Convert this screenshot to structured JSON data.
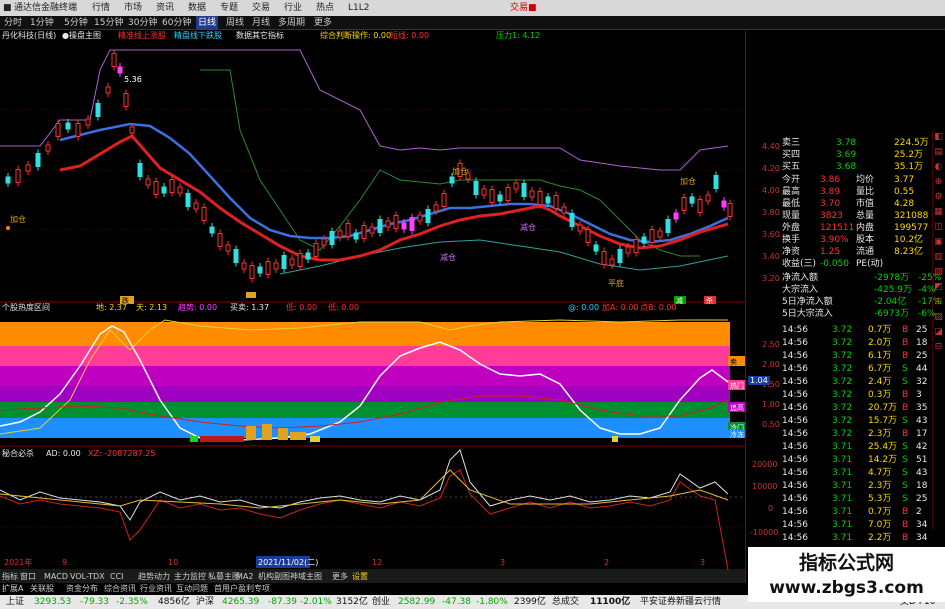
{
  "titlebar": {
    "app_title": "通达信金融终端",
    "menus": [
      "行情",
      "市场",
      "资讯",
      "数据",
      "专题",
      "交易",
      "行业",
      "热点",
      "L1L2"
    ],
    "right_label": "交易■"
  },
  "periods": [
    "分时",
    "1分钟",
    "5分钟",
    "15分钟",
    "30分钟",
    "60分钟",
    "日线",
    "周线",
    "月线",
    "多周期",
    "更多"
  ],
  "active_period": "日线",
  "main_legend": {
    "stock": "丹化科技(日线)",
    "indicator": "●操盘主图",
    "item1": "精准线上涨股",
    "item2": "精盘线下跌股",
    "item3": "数据其它指标",
    "item4": "综合判断操作: 0.00",
    "item5": "短线: 0.00",
    "item6": "压力1: 4.12",
    "price_peak": "5.36"
  },
  "sub_legend": {
    "name": "个股热度区间",
    "v1": "地: 2.37",
    "v2": "天: 2.13",
    "v3": "趋势: 0.00",
    "v4": "买卖: 1.37",
    "v5": "低: 0.00",
    "v6": "低: 0.00",
    "v7": "@: 0.00",
    "v8": "加A: 0.00",
    "v9": "点B: 0.00"
  },
  "ad_legend": {
    "name": "秘合必杀",
    "ad": "AD: 0.00",
    "xz": "XZ: -2087287.25"
  },
  "main_axis": [
    "4.40",
    "4.20",
    "4.00",
    "3.80",
    "3.60",
    "3.40",
    "3.20"
  ],
  "sub_axis": [
    "2.50",
    "2.00",
    "1.50",
    "1.00",
    "0.50"
  ],
  "ad_axis": [
    "20000",
    "10000",
    "0",
    "-10000"
  ],
  "zone_labels": [
    "卖",
    "热门",
    "追高",
    "冷门",
    "冷冻"
  ],
  "zone_value": "1.04",
  "chart_markers": {
    "buy_left": "加仓",
    "reduce": "减仓",
    "buy_mid": "加仓",
    "reduce2": "减仓",
    "buy_right": "加仓",
    "low_buy": "平底",
    "tag_jie": "跌",
    "tag_low": "低",
    "tag_mai": "减",
    "tag_ji": "杀"
  },
  "date_labels": [
    "2021年",
    "9",
    "10",
    "2021/11/02(二)",
    "12",
    "3",
    "2",
    "3"
  ],
  "quote": {
    "ask3": {
      "label": "卖三",
      "price": "3.78",
      "vol": "224.5万"
    },
    "ask4": {
      "label": "买四",
      "price": "3.69",
      "vol": "25.2万"
    },
    "ask5": {
      "label": "买五",
      "price": "3.68",
      "vol": "35.1万"
    },
    "rows": [
      {
        "l1": "今开",
        "v1": "3.86",
        "l2": "均价",
        "v2": "3.77"
      },
      {
        "l1": "最高",
        "v1": "3.89",
        "l2": "量比",
        "v2": "0.55"
      },
      {
        "l1": "最低",
        "v1": "3.70",
        "l2": "市值",
        "v2": "4.28"
      },
      {
        "l1": "现量",
        "v1": "3823",
        "l2": "总量",
        "v2": "321088"
      },
      {
        "l1": "外盘",
        "v1": "121511",
        "l2": "内盘",
        "v2": "199577"
      },
      {
        "l1": "换手",
        "v1": "3.90%",
        "l2": "股本",
        "v2": "10.2亿"
      },
      {
        "l1": "净资",
        "v1": "1.25",
        "l2": "流通",
        "v2": "8.23亿"
      },
      {
        "l1": "收益(三)",
        "v1": "-0.050",
        "l2": "PE(动)",
        "v2": ""
      }
    ],
    "flows": [
      {
        "label": "净流入额",
        "value": "-2978万",
        "pct": "-25%"
      },
      {
        "label": "大宗流入",
        "value": "-425.9万",
        "pct": "-4%"
      },
      {
        "label": "5日净流入额",
        "value": "-2.04亿",
        "pct": "-17%"
      },
      {
        "label": "5日大宗流入",
        "value": "-6973万",
        "pct": "-6%"
      }
    ]
  },
  "ticks": [
    {
      "t": "14:56",
      "p": "3.72",
      "v": "0.7万",
      "s": "B",
      "n": "25"
    },
    {
      "t": "14:56",
      "p": "3.72",
      "v": "2.0万",
      "s": "B",
      "n": "18"
    },
    {
      "t": "14:56",
      "p": "3.72",
      "v": "6.1万",
      "s": "B",
      "n": "25"
    },
    {
      "t": "14:56",
      "p": "3.72",
      "v": "6.7万",
      "s": "S",
      "n": "44"
    },
    {
      "t": "14:56",
      "p": "3.72",
      "v": "2.4万",
      "s": "S",
      "n": "32"
    },
    {
      "t": "14:56",
      "p": "3.72",
      "v": "0.3万",
      "s": "B",
      "n": "3"
    },
    {
      "t": "14:56",
      "p": "3.72",
      "v": "20.7万",
      "s": "B",
      "n": "35"
    },
    {
      "t": "14:56",
      "p": "3.72",
      "v": "15.7万",
      "s": "S",
      "n": "43"
    },
    {
      "t": "14:56",
      "p": "3.72",
      "v": "2.3万",
      "s": "B",
      "n": "17"
    },
    {
      "t": "14:56",
      "p": "3.71",
      "v": "25.4万",
      "s": "S",
      "n": "42"
    },
    {
      "t": "14:56",
      "p": "3.71",
      "v": "14.2万",
      "s": "S",
      "n": "51"
    },
    {
      "t": "14:56",
      "p": "3.71",
      "v": "4.7万",
      "s": "S",
      "n": "43"
    },
    {
      "t": "14:56",
      "p": "3.71",
      "v": "2.3万",
      "s": "S",
      "n": "18"
    },
    {
      "t": "14:56",
      "p": "3.71",
      "v": "5.3万",
      "s": "S",
      "n": "25"
    },
    {
      "t": "14:56",
      "p": "3.71",
      "v": "0.7万",
      "s": "B",
      "n": "2"
    },
    {
      "t": "14:56",
      "p": "3.71",
      "v": "7.0万",
      "s": "B",
      "n": "34"
    },
    {
      "t": "14:56",
      "p": "3.71",
      "v": "2.2万",
      "s": "B",
      "n": "34"
    }
  ],
  "tabs": [
    "指标",
    "窗口",
    "MACD",
    "VOL-TDX",
    "CCI",
    "趋势动力",
    "主力监控",
    "私募主图",
    "MA2",
    "机构副图",
    "神域主图",
    "更多",
    "设置"
  ],
  "status_line1": [
    "扩展A",
    "关联股",
    "资金分布",
    "综合资讯",
    "行业资讯",
    "互动问题",
    "首用户盈利专项"
  ],
  "status_line1_right": "模板",
  "status_line2": {
    "sh_label": "上证",
    "sh_val": "3293.53",
    "sh_chg": "-79.33",
    "sh_pct": "-2.35%",
    "sh_amt": "4856亿",
    "sz_label": "沪深",
    "sz_val": "4265.39",
    "sz_chg": "-87.39",
    "sz_pct": "-2.01%",
    "sz_amt": "3152亿",
    "cy_label": "创业",
    "cy_val": "2582.99",
    "cy_chg": "-47.38",
    "cy_pct": "-1.80%",
    "cy_amt": "2399亿",
    "total_label": "总成交",
    "total_val": "11100亿",
    "news": "平安证券新疆云行情",
    "code": "交D F10"
  },
  "watermark": {
    "line1": "指标公式网",
    "line2": "www.zbgs3.com"
  }
}
